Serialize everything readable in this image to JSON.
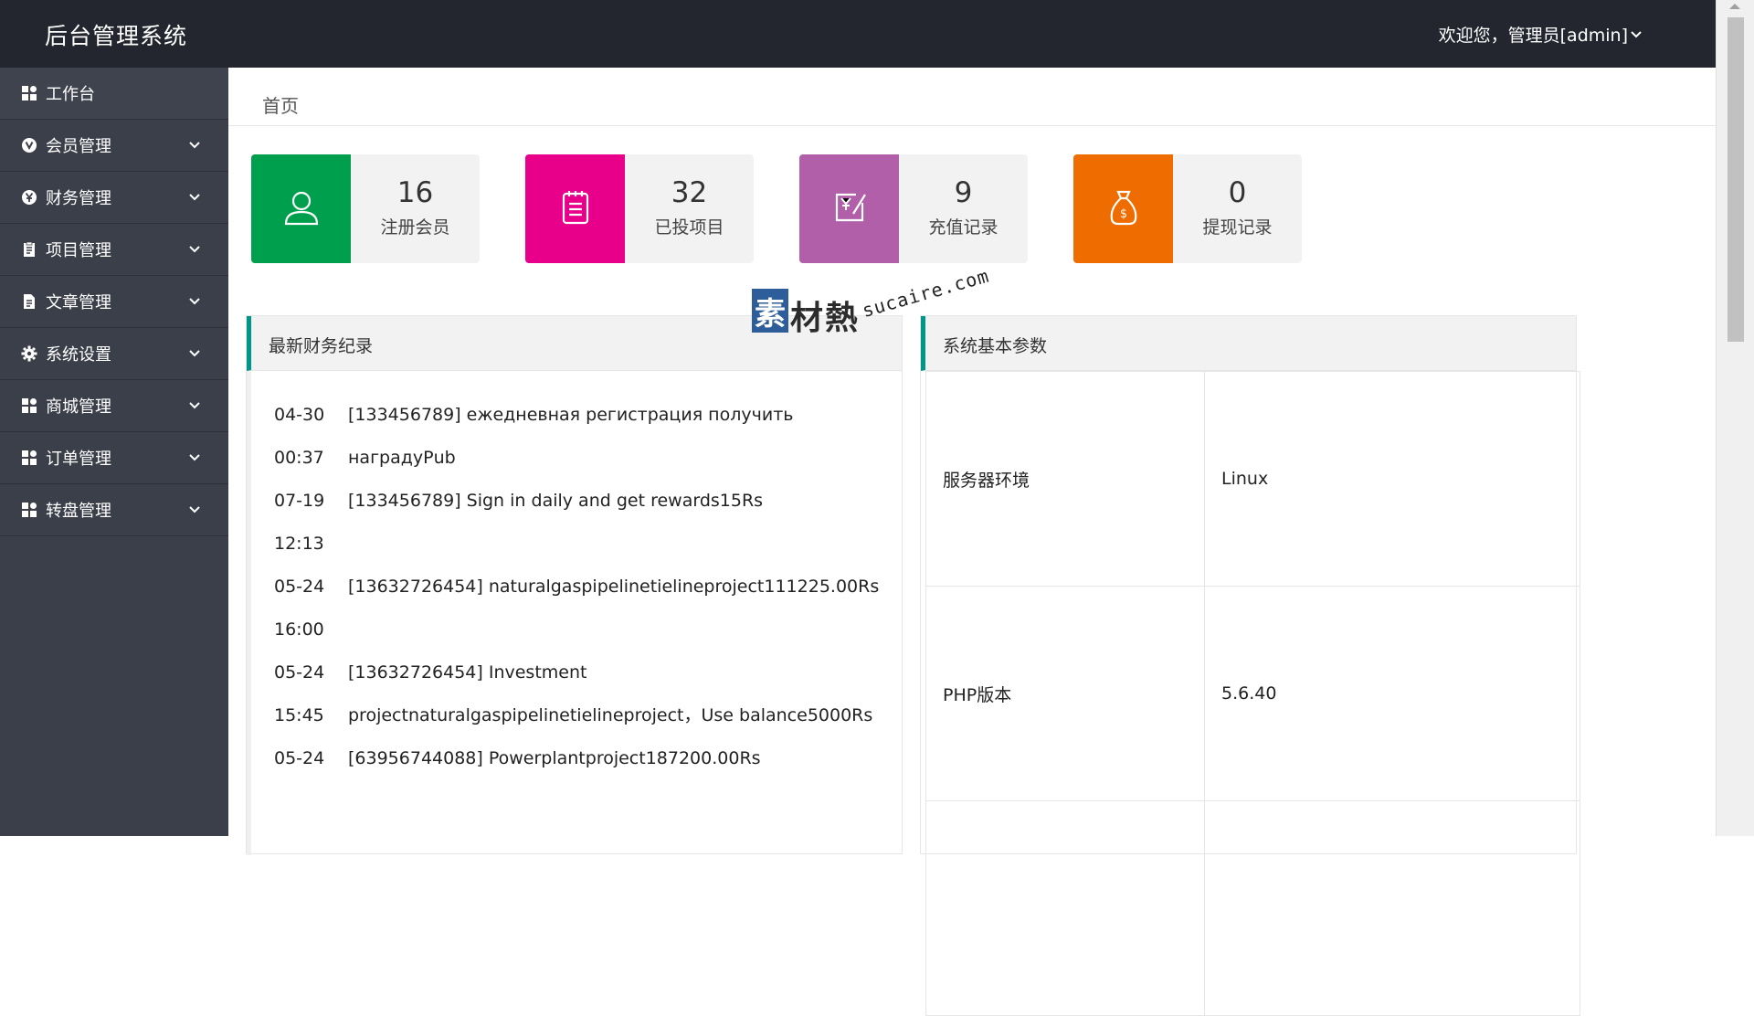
{
  "header": {
    "brand": "后台管理系统",
    "user_greeting": "欢迎您，管理员[admin]"
  },
  "sidebar": {
    "items": [
      {
        "label": "工作台",
        "icon": "grid-icon"
      },
      {
        "label": "会员管理",
        "icon": "vip-icon"
      },
      {
        "label": "财务管理",
        "icon": "yen-icon"
      },
      {
        "label": "项目管理",
        "icon": "clipboard-icon"
      },
      {
        "label": "文章管理",
        "icon": "document-icon"
      },
      {
        "label": "系统设置",
        "icon": "gear-icon"
      },
      {
        "label": "商城管理",
        "icon": "grid-icon"
      },
      {
        "label": "订单管理",
        "icon": "grid-icon"
      },
      {
        "label": "转盘管理",
        "icon": "grid-icon"
      }
    ]
  },
  "breadcrumb": "首页",
  "stats": [
    {
      "value": "16",
      "label": "注册会员",
      "color": "#009f4d",
      "icon": "user-icon"
    },
    {
      "value": "32",
      "label": "已投项目",
      "color": "#e8008a",
      "icon": "notepad-icon"
    },
    {
      "value": "9",
      "label": "充值记录",
      "color": "#b15fa9",
      "icon": "recharge-icon"
    },
    {
      "value": "0",
      "label": "提现记录",
      "color": "#ef6c00",
      "icon": "money-bag-icon"
    }
  ],
  "finance_panel": {
    "title": "最新财务纪录",
    "records": [
      {
        "date": "04-30",
        "time": "00:37",
        "text": "[133456789] ежедневная регистрация получить наградуРub"
      },
      {
        "date": "07-19",
        "time": "12:13",
        "text": "[133456789] Sign in daily and get rewards15Rs"
      },
      {
        "date": "05-24",
        "time": "16:00",
        "text": "[13632726454] naturalgaspipelinetielineproject111225.00Rs"
      },
      {
        "date": "05-24",
        "time": "15:45",
        "text": "[13632726454] Investment projectnaturalgaspipelinetielineproject，Use balance5000Rs"
      },
      {
        "date": "05-24",
        "time": "",
        "text": "[63956744088] Powerplantproject187200.00Rs"
      }
    ]
  },
  "params_panel": {
    "title": "系统基本参数",
    "rows": [
      {
        "key": "服务器环境",
        "value": "Linux"
      },
      {
        "key": "PHP版本",
        "value": "5.6.40"
      },
      {
        "key": "",
        "value": ""
      }
    ]
  },
  "watermark": {
    "box_char": "素",
    "cn": "材熱",
    "en": "sucaire.com"
  },
  "colors": {
    "header_bg": "#23262e",
    "sidebar_bg": "#3b3f4a",
    "accent": "#009688"
  }
}
